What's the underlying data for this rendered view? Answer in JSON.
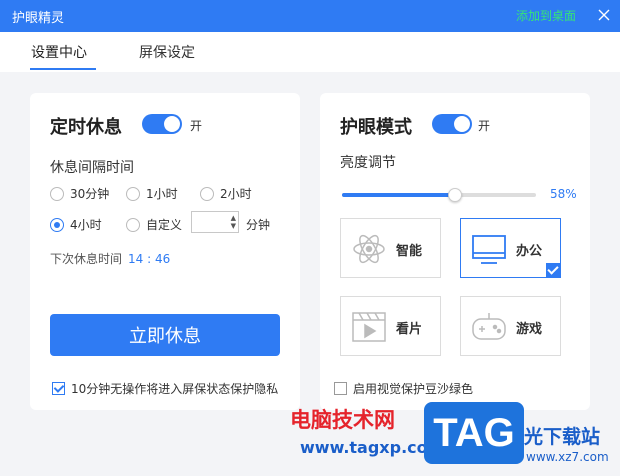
{
  "window": {
    "title": "护眼精灵",
    "desktop_link": "添加到桌面",
    "close_icon": "close-icon"
  },
  "tabs": [
    {
      "label": "设置中心",
      "active": true
    },
    {
      "label": "屏保设定",
      "active": false
    }
  ],
  "rest_card": {
    "title": "定时休息",
    "toggle_label": "开",
    "toggle_on": true,
    "interval_label": "休息间隔时间",
    "options": [
      "30分钟",
      "1小时",
      "2小时",
      "4小时",
      "自定义"
    ],
    "selected": "4小时",
    "custom_value": "",
    "custom_unit": "分钟",
    "next_rest_label": "下次休息时间",
    "next_rest_time": "14 : 46",
    "rest_now_button": "立即休息",
    "screensaver_checkbox": "10分钟无操作将进入屏保状态保护隐私",
    "screensaver_checked": true
  },
  "eye_card": {
    "title": "护眼模式",
    "toggle_label": "开",
    "toggle_on": true,
    "brightness_label": "亮度调节",
    "brightness_value": 0.58,
    "brightness_text": "58%",
    "modes": [
      {
        "label": "智能",
        "icon": "atom-icon",
        "active": false
      },
      {
        "label": "办公",
        "icon": "monitor-icon",
        "active": true
      },
      {
        "label": "看片",
        "icon": "film-icon",
        "active": false
      },
      {
        "label": "游戏",
        "icon": "gamepad-icon",
        "active": false
      }
    ],
    "green_checkbox": "启用视觉保护豆沙绿色",
    "green_checked": false
  },
  "watermark": {
    "text_cn": "电脑技术网",
    "url": "www.tagxp.com",
    "logo": "TAG",
    "site_cn": "光下载站",
    "site_url": "www.xz7.com"
  },
  "colors": {
    "accent": "#2f7bf3",
    "titlebar": "#2f7bf3",
    "desktop_link": "#36e27a"
  }
}
